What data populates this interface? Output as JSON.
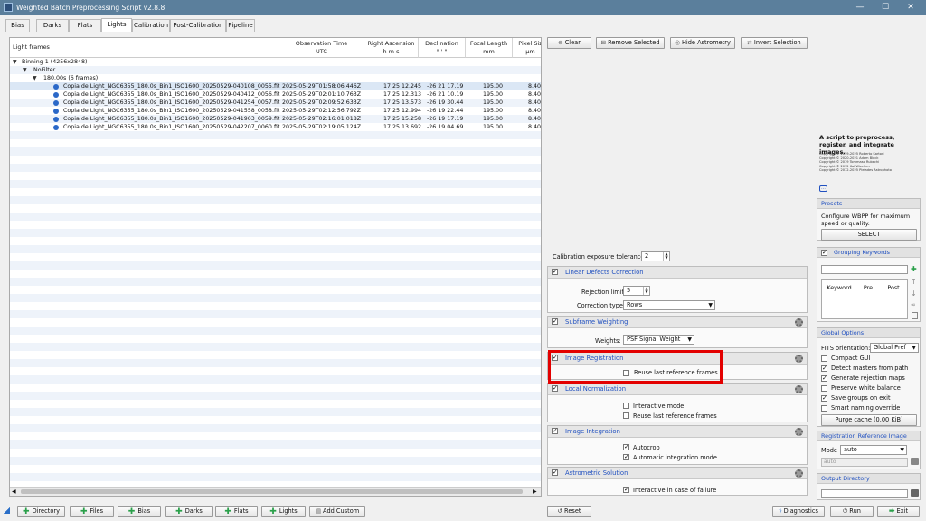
{
  "window": {
    "title": "Weighted Batch Preprocessing Script v2.8.8",
    "min": "—",
    "max": "☐",
    "close": "✕"
  },
  "tabs": [
    "Bias",
    "Darks",
    "Flats",
    "Lights",
    "Calibration",
    "Post-Calibration",
    "Pipeline"
  ],
  "tab_active": "Lights",
  "list": {
    "col_name": "Light frames",
    "col_obs": "Observation Time",
    "col_obs2": "UTC",
    "col_ra": "Right Ascension",
    "col_ra2": "h  m  s",
    "col_dec": "Declination",
    "col_dec2": "°  '  \"",
    "col_fl": "Focal Length",
    "col_fl2": "mm",
    "col_px": "Pixel Siz",
    "col_px2": "μm",
    "group1": "Binning 1 (4256x2848)",
    "group2": "NoFilter",
    "group3": "180.00s (6 frames)",
    "frames": [
      {
        "name": "Copia de Light_NGC6355_180.0s_Bin1_ISO1600_20250529-040108_0055.fit",
        "obs": "2025-05-29T01:58:06.446Z",
        "ra": "17 25 12.245",
        "dec": "-26 21 17.19",
        "fl": "195.00",
        "px": "8.40"
      },
      {
        "name": "Copia de Light_NGC6355_180.0s_Bin1_ISO1600_20250529-040412_0056.fit",
        "obs": "2025-05-29T02:01:10.763Z",
        "ra": "17 25 12.313",
        "dec": "-26 21 10.19",
        "fl": "195.00",
        "px": "8.40"
      },
      {
        "name": "Copia de Light_NGC6355_180.0s_Bin1_ISO1600_20250529-041254_0057.fit",
        "obs": "2025-05-29T02:09:52.633Z",
        "ra": "17 25 13.573",
        "dec": "-26 19 30.44",
        "fl": "195.00",
        "px": "8.40"
      },
      {
        "name": "Copia de Light_NGC6355_180.0s_Bin1_ISO1600_20250529-041558_0058.fit",
        "obs": "2025-05-29T02:12:56.792Z",
        "ra": "17 25 12.994",
        "dec": "-26 19 22.44",
        "fl": "195.00",
        "px": "8.40"
      },
      {
        "name": "Copia de Light_NGC6355_180.0s_Bin1_ISO1600_20250529-041903_0059.fit",
        "obs": "2025-05-29T02:16:01.018Z",
        "ra": "17 25 15.258",
        "dec": "-26 19 17.19",
        "fl": "195.00",
        "px": "8.40"
      },
      {
        "name": "Copia de Light_NGC6355_180.0s_Bin1_ISO1600_20250529-042207_0060.fit",
        "obs": "2025-05-29T02:19:05.124Z",
        "ra": "17 25 13.692",
        "dec": "-26 19 04.69",
        "fl": "195.00",
        "px": "8.40"
      }
    ]
  },
  "toolbar": {
    "clear": "Clear",
    "remove": "Remove Selected",
    "hide_astro": "Hide Astrometry",
    "invert": "Invert Selection"
  },
  "calib_tol": {
    "label": "Calibration exposure tolerance:",
    "value": "2"
  },
  "linear": {
    "title": "Linear Defects Correction",
    "rej_label": "Rejection limit:",
    "rej_value": "5",
    "type_label": "Correction type:",
    "type_value": "Rows"
  },
  "subframe": {
    "title": "Subframe Weighting",
    "weights_label": "Weights:",
    "weights_value": "PSF Signal Weight"
  },
  "registration": {
    "title": "Image Registration",
    "reuse": "Reuse last reference frames"
  },
  "localnorm": {
    "title": "Local Normalization",
    "interactive": "Interactive mode",
    "reuse": "Reuse last reference frames"
  },
  "integration": {
    "title": "Image Integration",
    "autocrop": "Autocrop",
    "auto_mode": "Automatic integration mode"
  },
  "astrometric": {
    "title": "Astrometric Solution",
    "interactive": "Interactive in case of failure"
  },
  "about": {
    "desc": "A script to preprocess, register, and integrate images.",
    "c1": "Copyright © 2019-2025 Roberto Sartori",
    "c2": "Copyright © 2020-2021 Adam Block",
    "c3": "Copyright © 2019 Tommaso Rubechi",
    "c4": "Copyright © 2012 Kai Wiechen",
    "c5": "Copyright © 2012-2025 Pleiades Astrophoto"
  },
  "presets": {
    "title": "Presets",
    "desc": "Configure WBPP for maximum speed or quality.",
    "select": "SELECT"
  },
  "grouping": {
    "title": "Grouping Keywords",
    "col1": "Keyword",
    "col2": "Pre",
    "col3": "Post"
  },
  "global": {
    "title": "Global Options",
    "fits_label": "FITS orientation:",
    "fits_value": "Global Pref",
    "compact": "Compact GUI",
    "detect": "Detect masters from path",
    "genrej": "Generate rejection maps",
    "preserve": "Preserve white balance",
    "savegroups": "Save groups on exit",
    "smartname": "Smart naming override",
    "purge": "Purge cache (0.00 KiB)"
  },
  "regref": {
    "title": "Registration Reference Image",
    "mode_label": "Mode",
    "mode_value": "auto",
    "auto_ph": "auto"
  },
  "outdir": {
    "title": "Output Directory"
  },
  "bottom": {
    "directory": "Directory",
    "files": "Files",
    "bias": "Bias",
    "darks": "Darks",
    "flats": "Flats",
    "lights": "Lights",
    "add_custom": "Add Custom",
    "reset": "Reset",
    "diagnostics": "Diagnostics",
    "run": "Run",
    "exit": "Exit"
  },
  "colors": {
    "accent": "#2050c0",
    "highlight": "#e30000",
    "titlebar": "#5b7f9c"
  }
}
